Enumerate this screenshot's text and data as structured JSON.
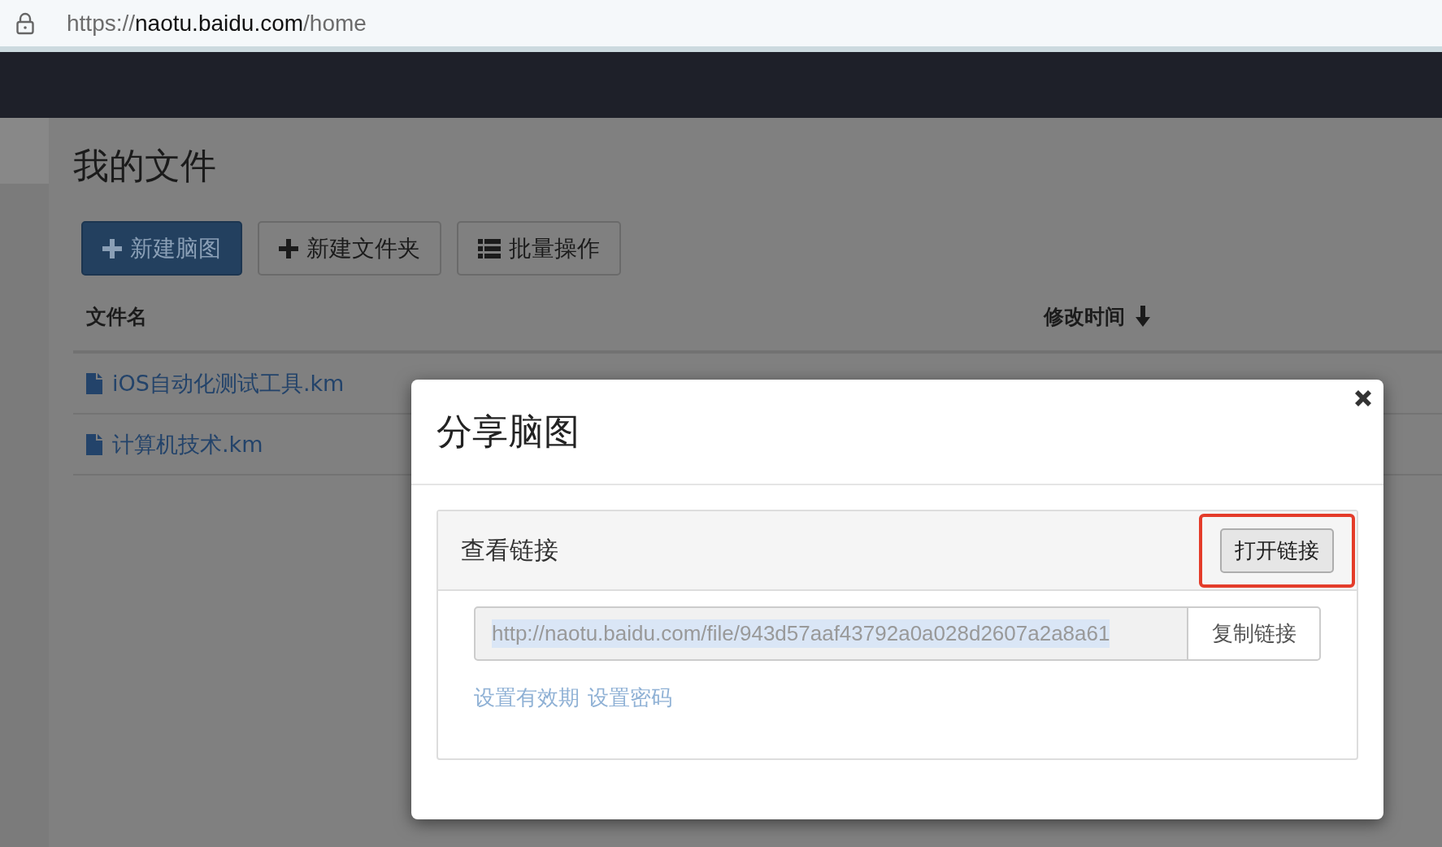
{
  "browser": {
    "url_scheme": "https://",
    "url_host": "naotu.baidu.com",
    "url_path": "/home"
  },
  "page": {
    "title": "我的文件",
    "toolbar": [
      {
        "label": "新建脑图",
        "kind": "primary"
      },
      {
        "label": "新建文件夹",
        "kind": "add"
      },
      {
        "label": "批量操作",
        "kind": "batch"
      }
    ],
    "table": {
      "columns": [
        {
          "label": "文件名",
          "sorted": false
        },
        {
          "label": "修改时间",
          "sorted": true
        }
      ],
      "rows": [
        {
          "name": "iOS自动化测试工具.km"
        },
        {
          "name": "计算机技术.km"
        }
      ]
    }
  },
  "dialog": {
    "title": "分享脑图",
    "panel": {
      "heading": "查看链接",
      "open_button": "打开链接",
      "highlighted": true,
      "link": {
        "value": "http://naotu.baidu.com/file/943d57aaf43792a0a028d2607a2a8a61",
        "selected": true
      },
      "copy_button": "复制链接",
      "options": [
        "设置有效期",
        "设置密码"
      ]
    }
  }
}
